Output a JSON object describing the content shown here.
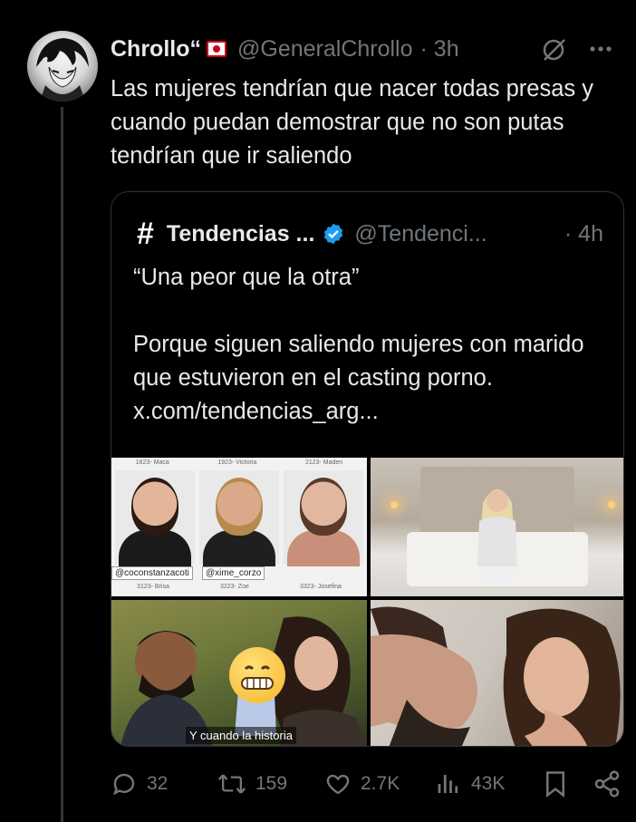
{
  "tweet": {
    "display_name": "Chrollo“",
    "handle": "@GeneralChrollo",
    "time": "· 3h",
    "text": "Las mujeres tendrían que nacer todas presas y cuando puedan demostrar que no son putas tendrían que ir saliendo"
  },
  "quote": {
    "name": "Tendencias ...",
    "handle": "@Tendenci...",
    "time": "· 4h",
    "text": "“Una peor que la otra”\n\nPorque siguen saliendo mujeres con marido que estuvieron en el casting porno.  x.com/tendencias_arg...",
    "media": {
      "casting_labels": [
        "1623- Maca",
        "1923- Victoria",
        "2123- Maden"
      ],
      "tag_left": "@coconstanzacoti",
      "tag_right": "@xime_corzo",
      "bottom_labels": [
        "3123- Brisa",
        "3223- Zoe",
        "3323- Josefina"
      ],
      "caption": "Y cuando la historia"
    }
  },
  "actions": {
    "replies": "32",
    "reposts": "159",
    "likes": "2.7K",
    "views": "43K"
  },
  "colors": {
    "background": "#000000",
    "text": "#e7e9ea",
    "muted": "#71767b",
    "border": "#2f3336",
    "verified": "#1d9bf0"
  },
  "icons": [
    "grok-icon",
    "more-icon",
    "verified-icon",
    "reply-icon",
    "repost-icon",
    "like-icon",
    "views-icon",
    "bookmark-icon",
    "share-icon"
  ]
}
